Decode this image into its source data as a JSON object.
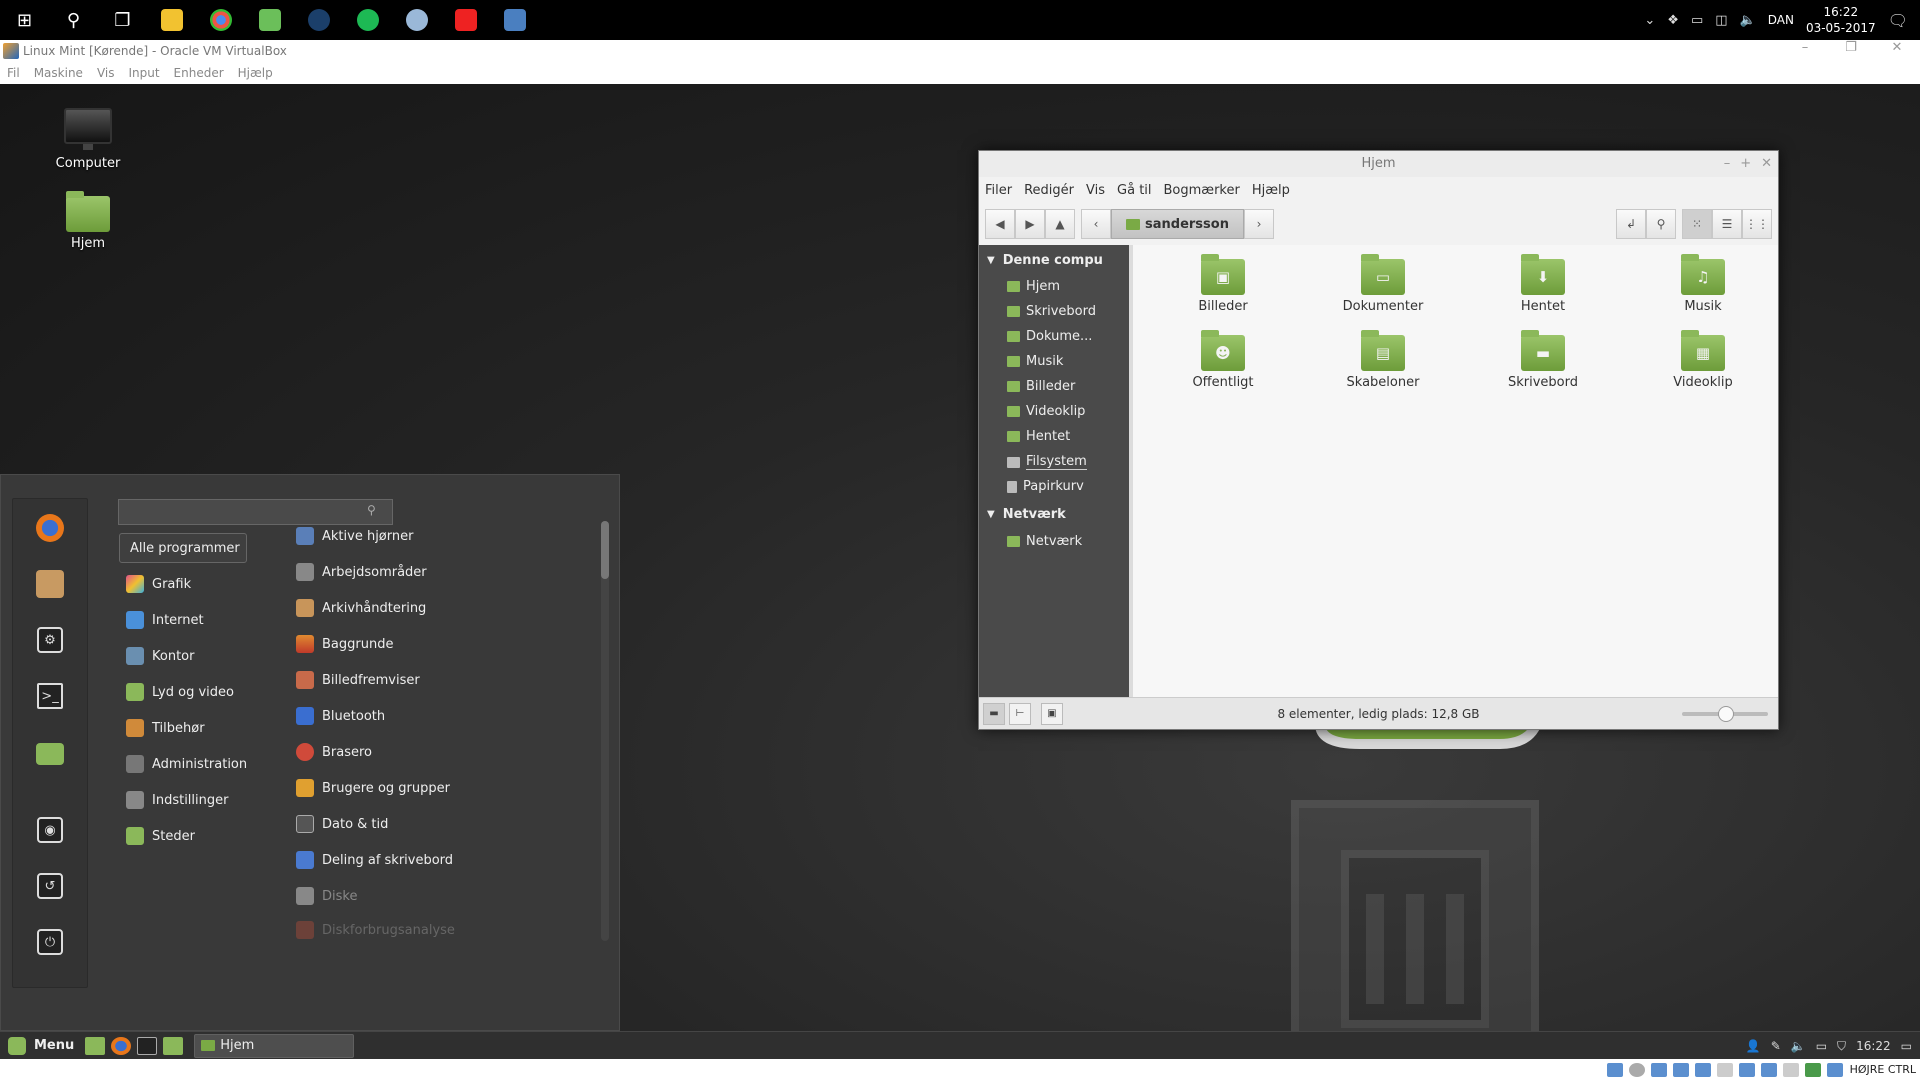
{
  "windows_taskbar": {
    "clock_time": "16:22",
    "clock_date": "03-05-2017",
    "language": "DAN"
  },
  "vbox": {
    "title": "Linux Mint [Kørende] - Oracle VM VirtualBox",
    "menu": [
      "Fil",
      "Maskine",
      "Vis",
      "Input",
      "Enheder",
      "Hjælp"
    ],
    "status_hostkey": "HØJRE CTRL"
  },
  "desktop": {
    "icons": [
      {
        "label": "Computer"
      },
      {
        "label": "Hjem"
      }
    ]
  },
  "mint_menu": {
    "search_value": "",
    "categories": [
      {
        "label": "Alle programmer",
        "color": ""
      },
      {
        "label": "Grafik",
        "color": "#e0508a"
      },
      {
        "label": "Internet",
        "color": "#4a90d9"
      },
      {
        "label": "Kontor",
        "color": "#6a8fb0"
      },
      {
        "label": "Lyd og video",
        "color": "#8bb85a"
      },
      {
        "label": "Tilbehør",
        "color": "#d08a3a"
      },
      {
        "label": "Administration",
        "color": "#777777"
      },
      {
        "label": "Indstillinger",
        "color": "#888888"
      },
      {
        "label": "Steder",
        "color": "#8bb85a"
      }
    ],
    "apps": [
      {
        "label": "Aktive hjørner",
        "color": "#5a7fb8"
      },
      {
        "label": "Arbejdsområder",
        "color": "#888888"
      },
      {
        "label": "Arkivhåndtering",
        "color": "#c8955a"
      },
      {
        "label": "Baggrunde",
        "color": "#e08a30"
      },
      {
        "label": "Billedfremviser",
        "color": "#c86a4a"
      },
      {
        "label": "Bluetooth",
        "color": "#3a6ed0"
      },
      {
        "label": "Brasero",
        "color": "#d04a3a"
      },
      {
        "label": "Brugere og grupper",
        "color": "#e0a030"
      },
      {
        "label": "Dato & tid",
        "color": "#555555"
      },
      {
        "label": "Deling af skrivebord",
        "color": "#4a7ad0"
      },
      {
        "label": "Diske",
        "color": "#888888"
      },
      {
        "label": "Diskforbrugsanalyse",
        "color": "#a04a3a"
      }
    ]
  },
  "nemo": {
    "title": "Hjem",
    "menu": [
      "Filer",
      "Redigér",
      "Vis",
      "Gå til",
      "Bogmærker",
      "Hjælp"
    ],
    "path_button": "sandersson",
    "sidebar": {
      "computer_header": "Denne compu",
      "computer_items": [
        "Hjem",
        "Skrivebord",
        "Dokume...",
        "Musik",
        "Billeder",
        "Videoklip",
        "Hentet",
        "Filsystem",
        "Papirkurv"
      ],
      "network_header": "Netværk",
      "network_items": [
        "Netværk"
      ]
    },
    "files": [
      {
        "label": "Billeder",
        "glyph": "▣"
      },
      {
        "label": "Dokumenter",
        "glyph": "▭"
      },
      {
        "label": "Hentet",
        "glyph": "⬇"
      },
      {
        "label": "Musik",
        "glyph": "♫"
      },
      {
        "label": "Offentligt",
        "glyph": "☻"
      },
      {
        "label": "Skabeloner",
        "glyph": "▤"
      },
      {
        "label": "Skrivebord",
        "glyph": "▬"
      },
      {
        "label": "Videoklip",
        "glyph": "▦"
      }
    ],
    "status": "8 elementer, ledig plads: 12,8 GB"
  },
  "mint_panel": {
    "menu_label": "Menu",
    "task_label": "Hjem",
    "clock": "16:22"
  }
}
